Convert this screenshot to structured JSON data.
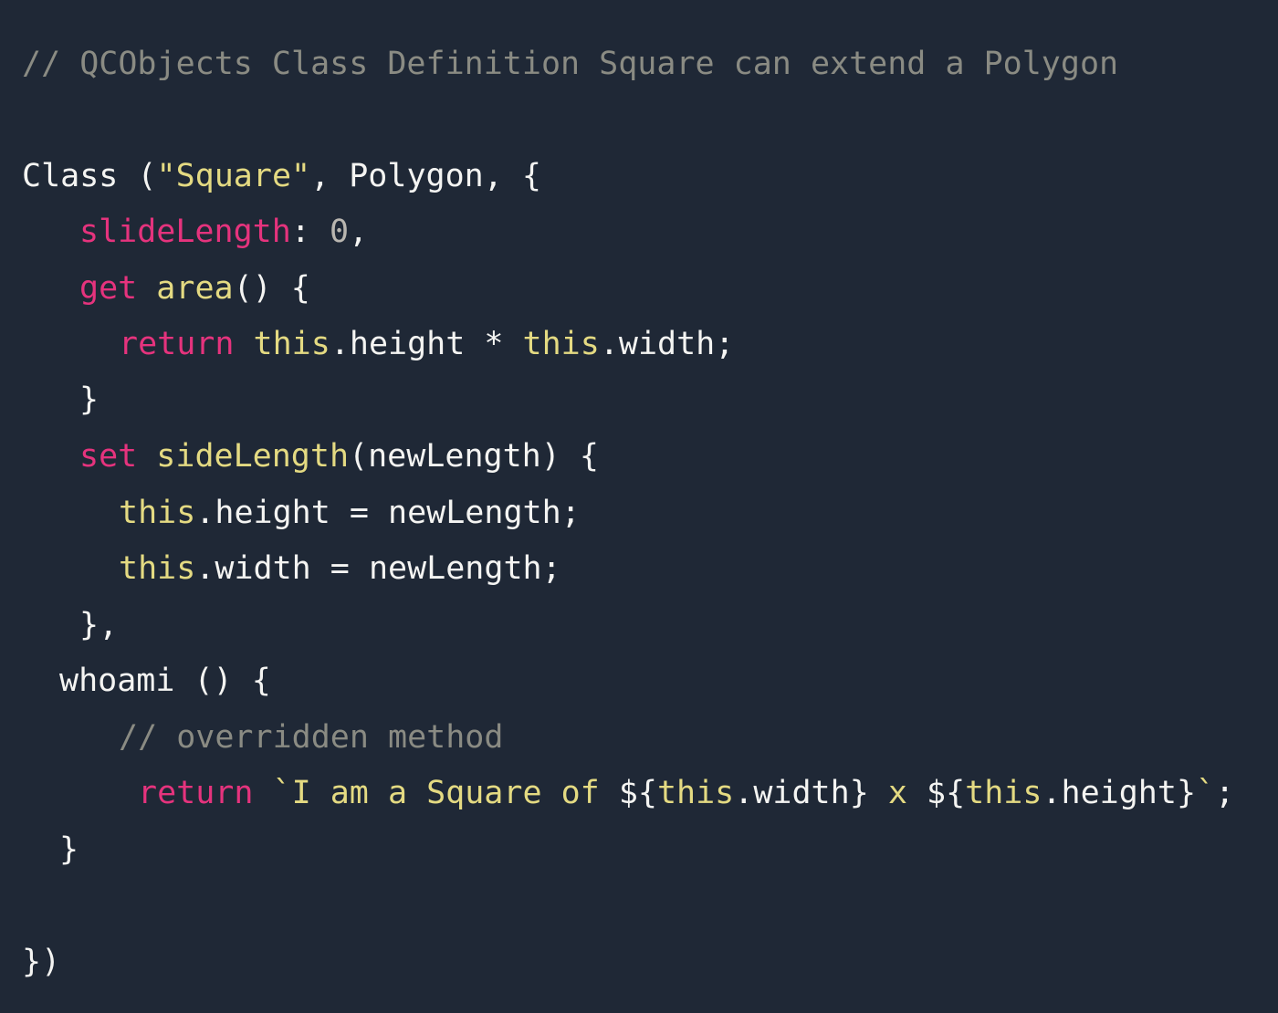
{
  "theme": {
    "background": "#1f2836",
    "plain": "#f4f4f2",
    "comment": "#8a8b83",
    "keyword": "#e5337d",
    "string": "#e4da82",
    "function": "#e4da82",
    "number": "#b9b6b0"
  },
  "code": {
    "lines": [
      {
        "tokens": [
          {
            "text": "// QCObjects Class Definition Square can extend a Polygon",
            "type": "comment"
          }
        ]
      },
      {
        "tokens": []
      },
      {
        "tokens": [
          {
            "text": "Class (",
            "type": "plain"
          },
          {
            "text": "\"Square\"",
            "type": "string"
          },
          {
            "text": ", Polygon, {",
            "type": "plain"
          }
        ]
      },
      {
        "tokens": [
          {
            "text": "slideLength",
            "type": "keyword"
          },
          {
            "text": ": ",
            "type": "plain"
          },
          {
            "text": "0",
            "type": "number"
          },
          {
            "text": ",",
            "type": "plain"
          }
        ]
      },
      {
        "tokens": [
          {
            "text": "get",
            "type": "keyword"
          },
          {
            "text": " ",
            "type": "plain"
          },
          {
            "text": "area",
            "type": "function"
          },
          {
            "text": "() {",
            "type": "plain"
          }
        ]
      },
      {
        "tokens": [
          {
            "text": "return",
            "type": "keyword"
          },
          {
            "text": " ",
            "type": "plain"
          },
          {
            "text": "this",
            "type": "function"
          },
          {
            "text": ".height * ",
            "type": "plain"
          },
          {
            "text": "this",
            "type": "function"
          },
          {
            "text": ".width;",
            "type": "plain"
          }
        ]
      },
      {
        "tokens": [
          {
            "text": "}",
            "type": "plain"
          }
        ]
      },
      {
        "tokens": [
          {
            "text": "set",
            "type": "keyword"
          },
          {
            "text": " ",
            "type": "plain"
          },
          {
            "text": "sideLength",
            "type": "function"
          },
          {
            "text": "(newLength) {",
            "type": "plain"
          }
        ]
      },
      {
        "tokens": [
          {
            "text": "this",
            "type": "function"
          },
          {
            "text": ".height = newLength;",
            "type": "plain"
          }
        ]
      },
      {
        "tokens": [
          {
            "text": "this",
            "type": "function"
          },
          {
            "text": ".width = newLength;",
            "type": "plain"
          }
        ]
      },
      {
        "tokens": [
          {
            "text": "},",
            "type": "plain"
          }
        ]
      },
      {
        "tokens": [
          {
            "text": "whoami () {",
            "type": "plain"
          }
        ]
      },
      {
        "tokens": [
          {
            "text": "// overridden method",
            "type": "comment"
          }
        ]
      },
      {
        "tokens": [
          {
            "text": "return",
            "type": "keyword"
          },
          {
            "text": " ",
            "type": "plain"
          },
          {
            "text": "`I am a Square of ",
            "type": "string"
          },
          {
            "text": "${",
            "type": "plain"
          },
          {
            "text": "this",
            "type": "function"
          },
          {
            "text": ".width}",
            "type": "plain"
          },
          {
            "text": " x ",
            "type": "string"
          },
          {
            "text": "${",
            "type": "plain"
          },
          {
            "text": "this",
            "type": "function"
          },
          {
            "text": ".height}",
            "type": "plain"
          },
          {
            "text": "`",
            "type": "string"
          },
          {
            "text": ";",
            "type": "plain"
          }
        ]
      },
      {
        "tokens": [
          {
            "text": "}",
            "type": "plain"
          }
        ]
      },
      {
        "tokens": []
      },
      {
        "tokens": [
          {
            "text": "})",
            "type": "plain"
          }
        ]
      }
    ]
  }
}
